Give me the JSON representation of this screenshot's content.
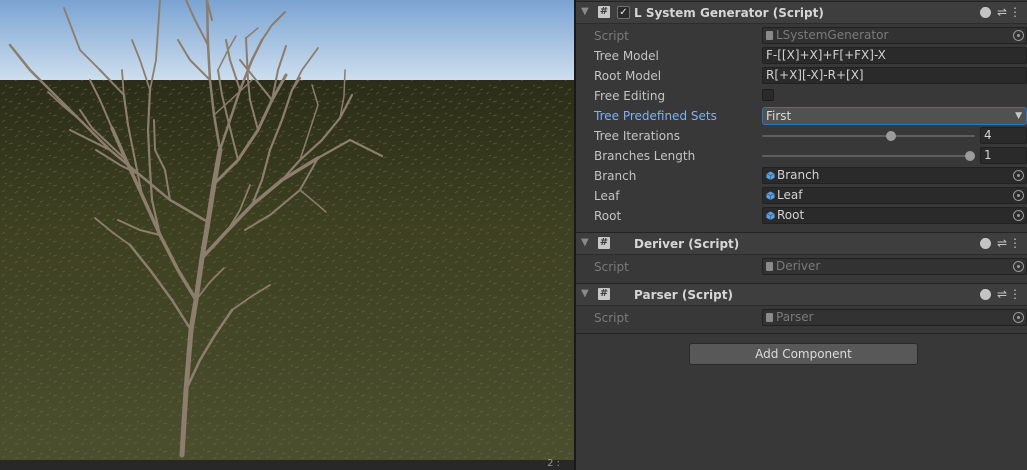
{
  "scene": {
    "footer_text": "2 :",
    "colors": {
      "sky_top": "#7ea6d4",
      "sky_horizon": "#c9dcee",
      "ground": "#3f4222",
      "tree": "#8c7d6d"
    }
  },
  "inspector": {
    "lsystem": {
      "title": "L System Generator (Script)",
      "enabled": true,
      "script_label": "Script",
      "script_value": "LSystemGenerator",
      "tree_model_label": "Tree Model",
      "tree_model_value": "F-[[X]+X]+F[+FX]-X",
      "root_model_label": "Root Model",
      "root_model_value": "R[+X][-X]-R+[X]",
      "free_editing_label": "Free Editing",
      "free_editing_checked": false,
      "tree_sets_label": "Tree Predefined Sets",
      "tree_sets_value": "First",
      "tree_iterations_label": "Tree Iterations",
      "tree_iterations_value": "4",
      "tree_iterations_fraction": 0.61,
      "branches_length_label": "Branches Length",
      "branches_length_value": "1",
      "branches_length_fraction": 1.0,
      "branch_label": "Branch",
      "branch_value": "Branch",
      "leaf_label": "Leaf",
      "leaf_value": "Leaf",
      "root_label": "Root",
      "root_value": "Root"
    },
    "deriver": {
      "title": "Deriver (Script)",
      "script_label": "Script",
      "script_value": "Deriver"
    },
    "parser": {
      "title": "Parser (Script)",
      "script_label": "Script",
      "script_value": "Parser"
    },
    "add_component_label": "Add Component",
    "icons": {
      "fold": "fold-arrow-icon",
      "component": "script-component-icon",
      "help": "help-icon",
      "presets": "presets-icon",
      "menu": "kebab-menu-icon",
      "picker": "object-picker-icon",
      "prefab": "prefab-icon"
    }
  }
}
